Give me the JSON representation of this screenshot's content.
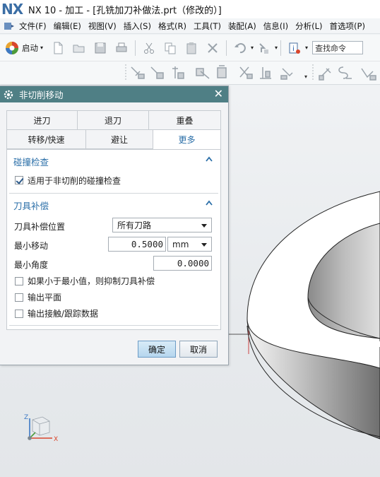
{
  "window": {
    "logo": "NX",
    "title": "NX 10 - 加工 - [孔铣加刀补做法.prt（修改的）]"
  },
  "menu": {
    "items": [
      "文件(F)",
      "编辑(E)",
      "视图(V)",
      "插入(S)",
      "格式(R)",
      "工具(T)",
      "装配(A)",
      "信息(I)",
      "分析(L)",
      "首选项(P)"
    ]
  },
  "toolbar": {
    "start_label": "启动",
    "find_command_placeholder": "查找命令"
  },
  "dialog": {
    "title": "非切削移动",
    "tabs_row1": [
      "进刀",
      "退刀",
      "重叠"
    ],
    "tabs_row2": [
      "转移/快速",
      "避让",
      "更多"
    ],
    "active_tab": "更多",
    "collision": {
      "title": "碰撞检查",
      "checkbox_label": "适用于非切削的碰撞检查",
      "checked": true
    },
    "cutter_comp": {
      "title": "刀具补偿",
      "position_label": "刀具补偿位置",
      "position_value": "所有刀路",
      "min_move_label": "最小移动",
      "min_move_value": "0.5000",
      "min_move_unit": "mm",
      "min_angle_label": "最小角度",
      "min_angle_value": "0.0000",
      "check1_label": "如果小于最小值，则抑制刀具补偿",
      "check2_label": "输出平面",
      "check3_label": "输出接触/跟踪数据"
    },
    "ok_label": "确定",
    "cancel_label": "取消"
  },
  "triad": {
    "z_label": "Z",
    "x_label": "X"
  },
  "colors": {
    "dialog_header": "#4f7f85",
    "accent": "#2b6fa8"
  }
}
